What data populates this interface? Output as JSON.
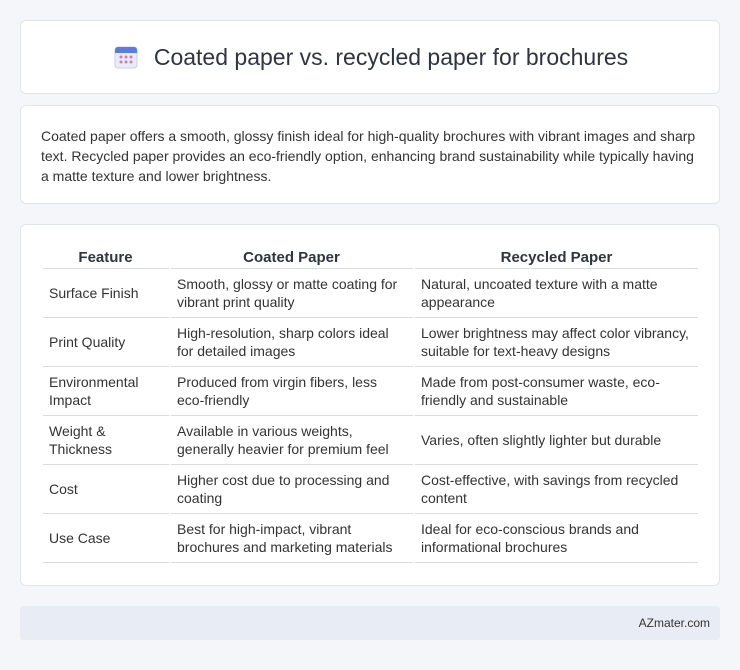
{
  "header": {
    "title": "Coated paper vs. recycled paper for brochures",
    "icon": "calendar-icon"
  },
  "intro": {
    "text": "Coated paper offers a smooth, glossy finish ideal for high-quality brochures with vibrant images and sharp text. Recycled paper provides an eco-friendly option, enhancing brand sustainability while typically having a matte texture and lower brightness."
  },
  "table": {
    "headers": [
      "Feature",
      "Coated Paper",
      "Recycled Paper"
    ],
    "rows": [
      {
        "feature": "Surface Finish",
        "coated": "Smooth, glossy or matte coating for vibrant print quality",
        "recycled": "Natural, uncoated texture with a matte appearance"
      },
      {
        "feature": "Print Quality",
        "coated": "High-resolution, sharp colors ideal for detailed images",
        "recycled": "Lower brightness may affect color vibrancy, suitable for text-heavy designs"
      },
      {
        "feature": "Environmental Impact",
        "coated": "Produced from virgin fibers, less eco-friendly",
        "recycled": "Made from post-consumer waste, eco-friendly and sustainable"
      },
      {
        "feature": "Weight & Thickness",
        "coated": "Available in various weights, generally heavier for premium feel",
        "recycled": "Varies, often slightly lighter but durable"
      },
      {
        "feature": "Cost",
        "coated": "Higher cost due to processing and coating",
        "recycled": "Cost-effective, with savings from recycled content"
      },
      {
        "feature": "Use Case",
        "coated": "Best for high-impact, vibrant brochures and marketing materials",
        "recycled": "Ideal for eco-conscious brands and informational brochures"
      }
    ]
  },
  "footer": {
    "text": "AZmater.com"
  }
}
